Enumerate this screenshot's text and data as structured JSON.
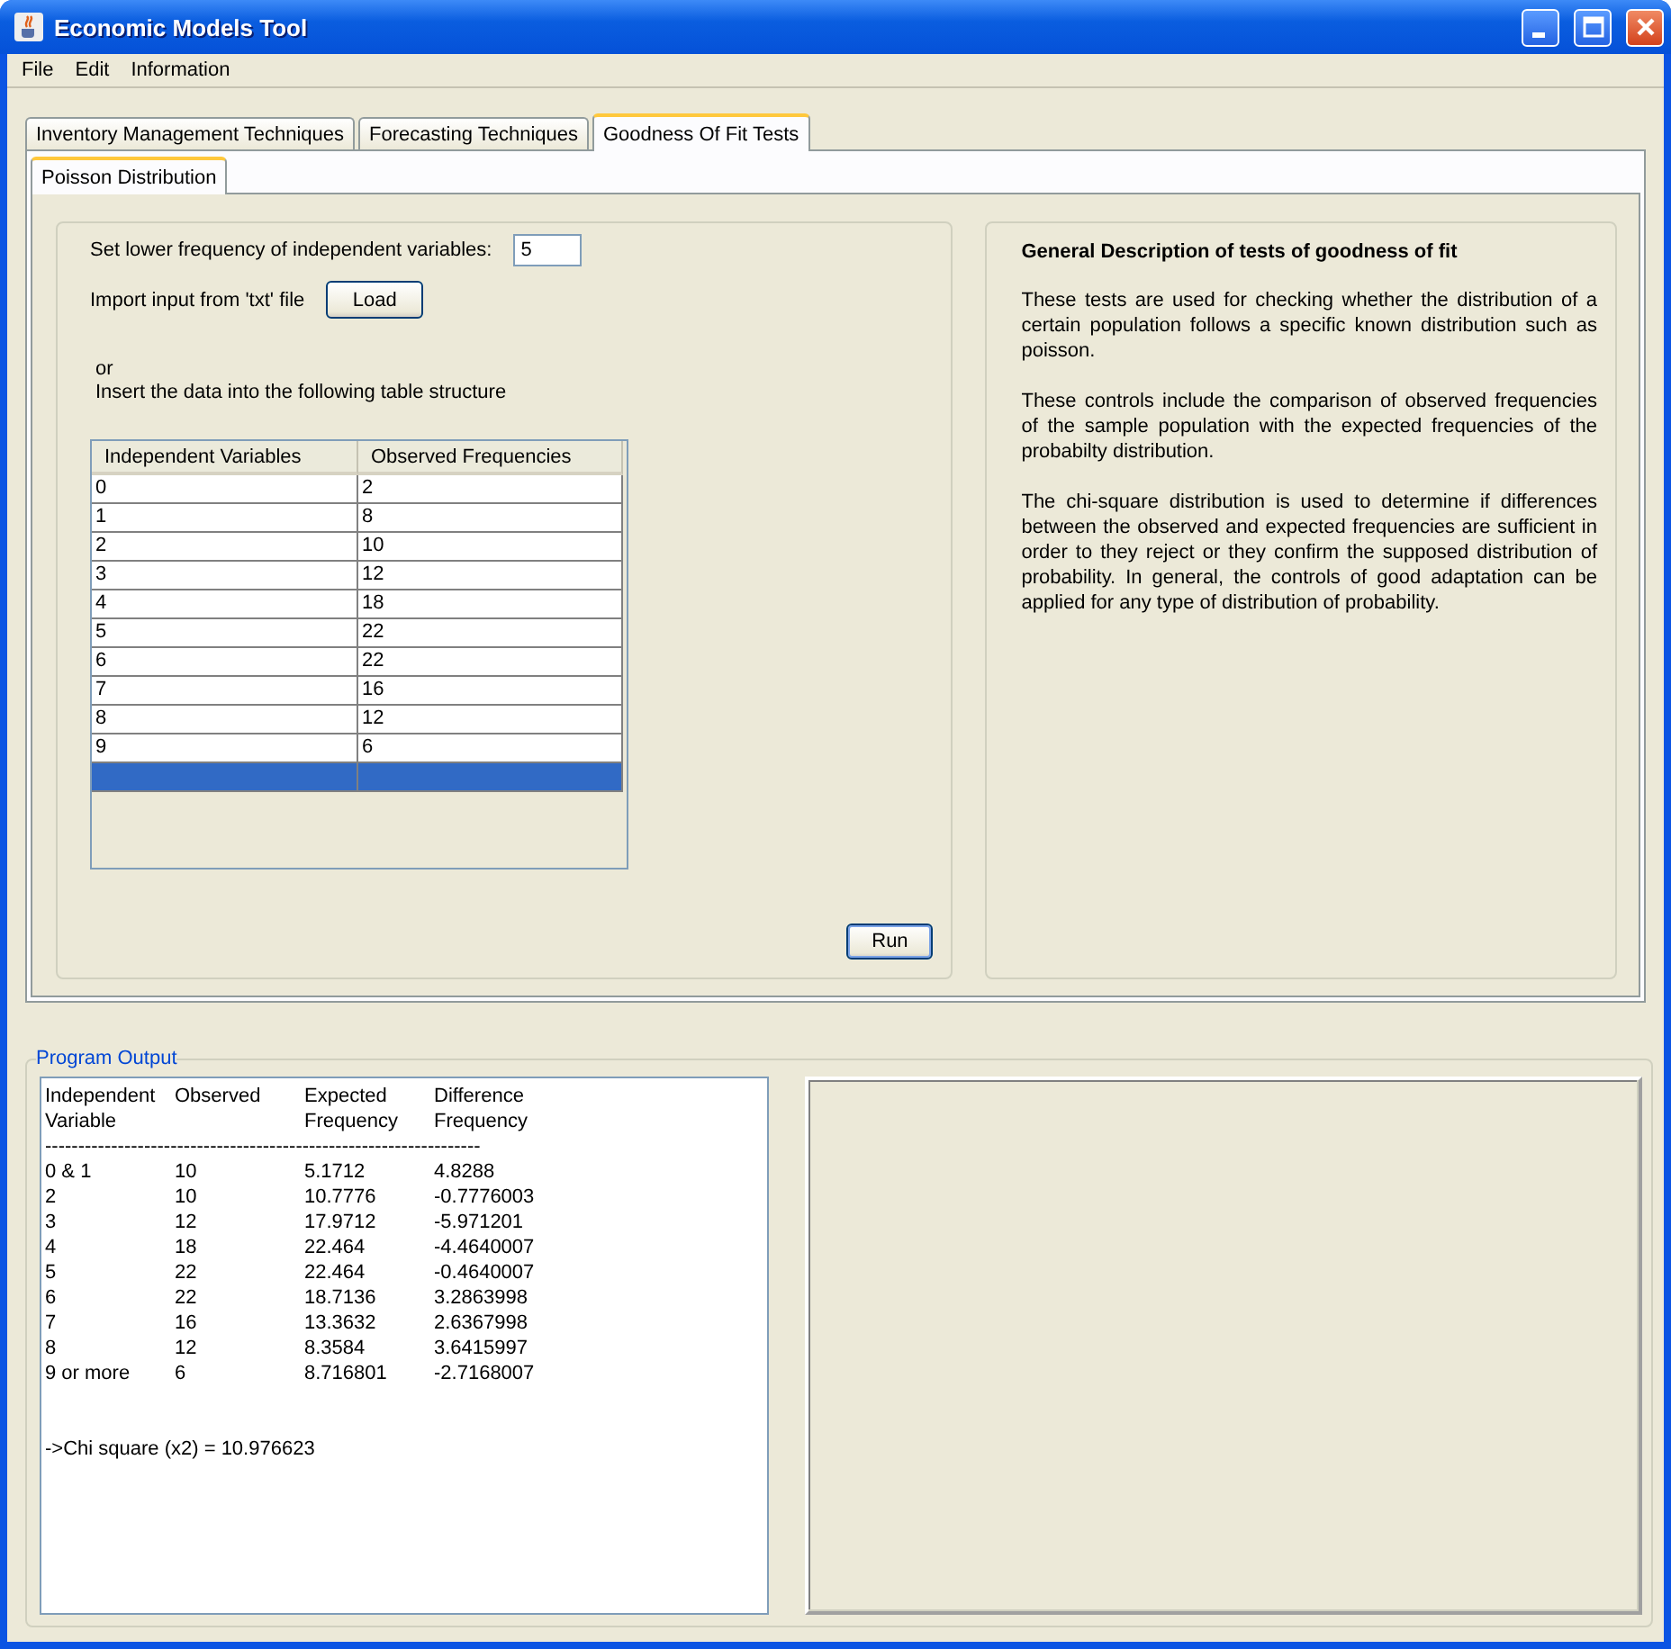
{
  "window": {
    "title": "Economic Models Tool"
  },
  "menu": [
    "File",
    "Edit",
    "Information"
  ],
  "tabs": [
    {
      "label": "Inventory Management Techniques",
      "selected": false
    },
    {
      "label": "Forecasting Techniques",
      "selected": false
    },
    {
      "label": "Goodness Of Fit Tests",
      "selected": true
    }
  ],
  "subtabs": [
    {
      "label": "Poisson Distribution",
      "selected": true
    }
  ],
  "input_panel": {
    "frequency_label": "Set lower frequency of independent variables:",
    "frequency_value": "5",
    "import_label": "Import input from 'txt' file",
    "load_button": "Load",
    "or_text": "or",
    "insert_text": "Insert the data into the following table structure",
    "run_button": "Run"
  },
  "table": {
    "columns": [
      "Independent Variables",
      "Observed Frequencies"
    ],
    "rows": [
      {
        "cells": [
          "0",
          "2"
        ],
        "selected": false
      },
      {
        "cells": [
          "1",
          "8"
        ],
        "selected": false
      },
      {
        "cells": [
          "2",
          "10"
        ],
        "selected": false
      },
      {
        "cells": [
          "3",
          "12"
        ],
        "selected": false
      },
      {
        "cells": [
          "4",
          "18"
        ],
        "selected": false
      },
      {
        "cells": [
          "5",
          "22"
        ],
        "selected": false
      },
      {
        "cells": [
          "6",
          "22"
        ],
        "selected": false
      },
      {
        "cells": [
          "7",
          "16"
        ],
        "selected": false
      },
      {
        "cells": [
          "8",
          "12"
        ],
        "selected": false
      },
      {
        "cells": [
          "9",
          "6"
        ],
        "selected": false
      }
    ],
    "blank_row": {
      "selected": true
    }
  },
  "description": {
    "title": "General Description of tests of goodness of fit",
    "paragraphs": [
      "These tests are used for checking whether the distribution of a certain population follows a specific known distribution such as poisson.",
      "These controls include the comparison of observed frequencies of the sample population with the expected frequencies of the probabilty distribution.",
      "The chi-square distribution is used to determine if differences between the observed and expected frequencies are sufficient in order to they reject or they confirm the supposed distribution of probability. In general, the controls of good adaptation can be applied for any type of distribution of probability."
    ]
  },
  "output": {
    "title": "Program Output",
    "headers": [
      [
        "Independent",
        "Variable"
      ],
      [
        "Observed"
      ],
      [
        "Expected",
        "Frequency"
      ],
      [
        "Difference",
        "Frequency"
      ]
    ],
    "separator": "------------------------------------------------------------------",
    "rows": [
      [
        "0 & 1",
        "10",
        "5.1712",
        "4.8288"
      ],
      [
        "2",
        "10",
        "10.7776",
        "-0.7776003"
      ],
      [
        "3",
        "12",
        "17.9712",
        "-5.971201"
      ],
      [
        "4",
        "18",
        "22.464",
        "-4.4640007"
      ],
      [
        "5",
        "22",
        "22.464",
        "-0.4640007"
      ],
      [
        "6",
        "22",
        "18.7136",
        "3.2863998"
      ],
      [
        "7",
        "16",
        "13.3632",
        "2.6367998"
      ],
      [
        "8",
        "12",
        "8.3584",
        "3.6415997"
      ],
      [
        "9 or more",
        "6",
        "8.716801",
        "-2.7168007"
      ]
    ],
    "result": "->Chi square (x2) = 10.976623"
  }
}
